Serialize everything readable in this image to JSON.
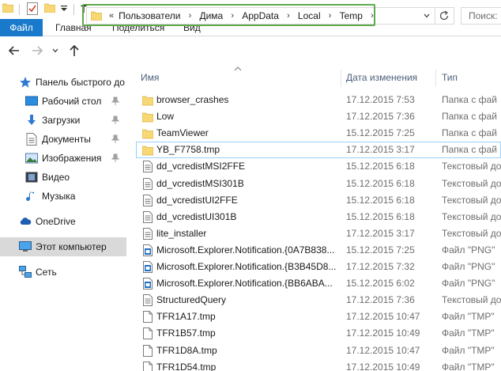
{
  "window": {
    "title": "Temp"
  },
  "ribbon": {
    "tabs": [
      {
        "label": "Файл"
      },
      {
        "label": "Главная"
      },
      {
        "label": "Поделиться"
      },
      {
        "label": "Вид"
      }
    ]
  },
  "address": {
    "lead": "«",
    "breadcrumb": [
      "Пользователи",
      "Дима",
      "AppData",
      "Local",
      "Temp"
    ],
    "search_placeholder": "Поиск:"
  },
  "sidebar": {
    "items": [
      {
        "label": "Панель быстрого до",
        "icon": "star-icon",
        "pinned": false
      },
      {
        "label": "Рабочий стол",
        "icon": "desktop-icon",
        "pinned": true
      },
      {
        "label": "Загрузки",
        "icon": "download-icon",
        "pinned": true
      },
      {
        "label": "Документы",
        "icon": "documents-icon",
        "pinned": true
      },
      {
        "label": "Изображения",
        "icon": "pictures-icon",
        "pinned": true
      },
      {
        "label": "Видео",
        "icon": "video-icon",
        "pinned": false
      },
      {
        "label": "Музыка",
        "icon": "music-icon",
        "pinned": false
      },
      {
        "label": "OneDrive",
        "icon": "cloud-icon",
        "pinned": false
      },
      {
        "label": "Этот компьютер",
        "icon": "computer-icon",
        "pinned": false,
        "selected": true
      },
      {
        "label": "Сеть",
        "icon": "network-icon",
        "pinned": false
      }
    ]
  },
  "columns": {
    "name": "Имя",
    "date": "Дата изменения",
    "type": "Тип"
  },
  "files": [
    {
      "name": "browser_crashes",
      "date": "17.12.2015 7:53",
      "type": "Папка с фай",
      "icon": "folder-icon"
    },
    {
      "name": "Low",
      "date": "17.12.2015 7:36",
      "type": "Папка с фай",
      "icon": "folder-icon"
    },
    {
      "name": "TeamViewer",
      "date": "15.12.2015 7:25",
      "type": "Папка с фай",
      "icon": "folder-icon"
    },
    {
      "name": "YB_F7758.tmp",
      "date": "17.12.2015 3:17",
      "type": "Папка с фай",
      "icon": "folder-icon",
      "highlighted": true
    },
    {
      "name": "dd_vcredistMSI2FFE",
      "date": "15.12.2015 6:18",
      "type": "Текстовый до",
      "icon": "text-file-icon"
    },
    {
      "name": "dd_vcredistMSI301B",
      "date": "15.12.2015 6:18",
      "type": "Текстовый до",
      "icon": "text-file-icon"
    },
    {
      "name": "dd_vcredistUI2FFE",
      "date": "15.12.2015 6:18",
      "type": "Текстовый до",
      "icon": "text-file-icon"
    },
    {
      "name": "dd_vcredistUI301B",
      "date": "15.12.2015 6:18",
      "type": "Текстовый до",
      "icon": "text-file-icon"
    },
    {
      "name": "lite_installer",
      "date": "17.12.2015 3:17",
      "type": "Текстовый до",
      "icon": "text-file-icon"
    },
    {
      "name": "Microsoft.Explorer.Notification.{0A7B838...",
      "date": "15.12.2015 7:25",
      "type": "Файл \"PNG\"",
      "icon": "png-file-icon"
    },
    {
      "name": "Microsoft.Explorer.Notification.{B3B45D8...",
      "date": "17.12.2015 7:32",
      "type": "Файл \"PNG\"",
      "icon": "png-file-icon"
    },
    {
      "name": "Microsoft.Explorer.Notification.{BB6ABA...",
      "date": "15.12.2015 6:02",
      "type": "Файл \"PNG\"",
      "icon": "png-file-icon"
    },
    {
      "name": "StructuredQuery",
      "date": "17.12.2015 7:36",
      "type": "Текстовый до",
      "icon": "text-file-icon"
    },
    {
      "name": "TFR1A17.tmp",
      "date": "17.12.2015 10:47",
      "type": "Файл \"TMP\"",
      "icon": "blank-file-icon"
    },
    {
      "name": "TFR1B57.tmp",
      "date": "17.12.2015 10:49",
      "type": "Файл \"TMP\"",
      "icon": "blank-file-icon"
    },
    {
      "name": "TFR1D8A.tmp",
      "date": "17.12.2015 10:47",
      "type": "Файл \"TMP\"",
      "icon": "blank-file-icon"
    },
    {
      "name": "TFR1D54.tmp",
      "date": "17.12.2015 10:49",
      "type": "Файл \"TMP\"",
      "icon": "blank-file-icon"
    }
  ],
  "colors": {
    "file_tab": "#1979ca",
    "address_highlight": "#5faa4d",
    "row_highlight_border": "#99d1ff",
    "folder_yellow": "#f8d775",
    "selected_sidebar": "#d9d9d9"
  }
}
